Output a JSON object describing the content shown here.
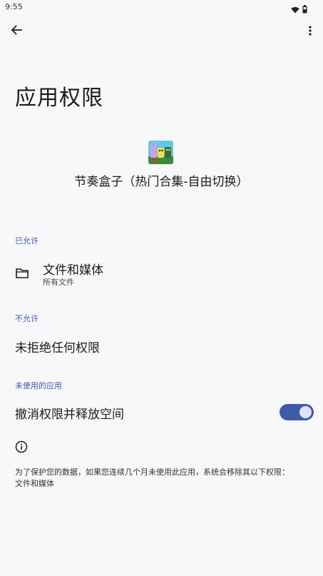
{
  "status_bar": {
    "time": "9:55",
    "icons": [
      "wifi-icon",
      "battery-icon"
    ]
  },
  "toolbar": {
    "back_icon": "arrow-back-icon",
    "more_icon": "more-vert-icon"
  },
  "page": {
    "title": "应用权限"
  },
  "app": {
    "name": "节奏盒子（热门合集-自由切换）",
    "icon": "app-icon"
  },
  "sections": {
    "allowed": {
      "header": "已允许",
      "items": [
        {
          "title": "文件和媒体",
          "subtitle": "所有文件",
          "icon": "folder-icon"
        }
      ]
    },
    "denied": {
      "header": "不允许",
      "empty_text": "未拒绝任何权限"
    },
    "unused": {
      "header": "未使用的应用",
      "toggle_label": "撤消权限并释放空间",
      "toggle_on": true
    }
  },
  "footer": {
    "info_icon": "info-icon",
    "note_line1": "为了保护您的数据，如果您连续几个月未使用此应用，系统会移除其以下权限：",
    "note_line2": "文件和媒体"
  },
  "colors": {
    "accent": "#3f5aa8",
    "background": "#f8f8fb",
    "text": "#1b1b1f"
  }
}
